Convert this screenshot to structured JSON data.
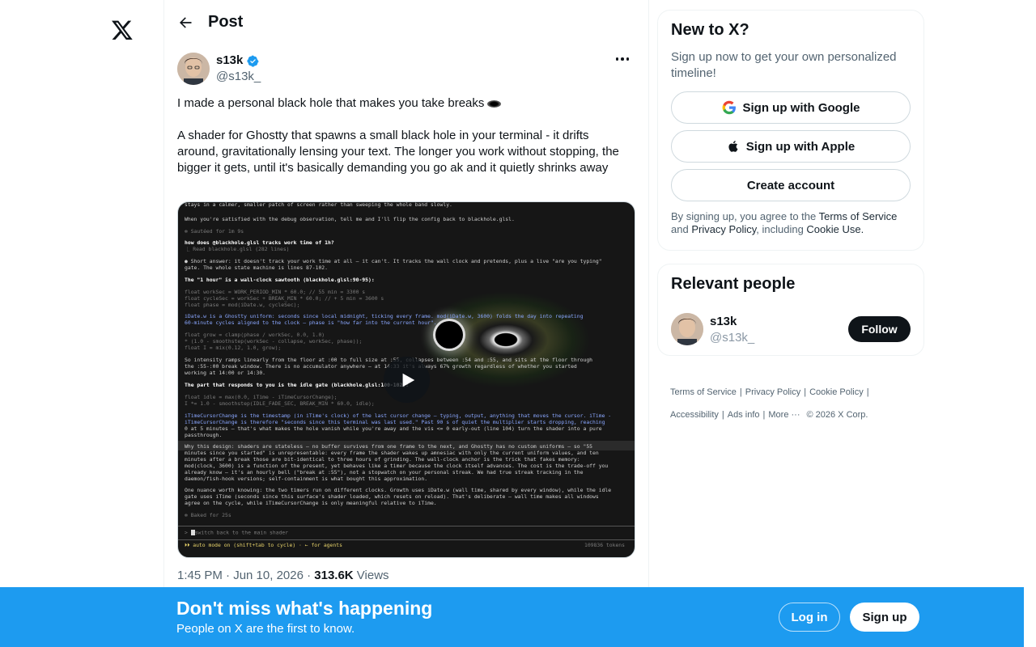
{
  "header": {
    "title": "Post"
  },
  "author": {
    "name": "s13k",
    "handle": "@s13k_"
  },
  "post": {
    "line1": "I made a personal black hole that makes you take breaks",
    "line2": "A shader for Ghostty that spawns a small black hole in your terminal - it drifts around, gravitationally lensing your text. The longer you work without stopping, the bigger it gets, until it's basically demanding you go ak and it quietly shrinks away",
    "time": "1:45 PM · Jun 10, 2026 · ",
    "views": "313.6K",
    "views_label": " Views"
  },
  "terminal": {
    "lines": [
      "stays in a calmer, smaller patch of screen rather than sweeping the whole band slowly.",
      "When you're satisfied with the debug observation, tell me and I'll flip the config back to blackhole.glsl.",
      "✻ Sautéed for 1m 9s",
      "how does @blackhole.glsl tracks work time of 1h?",
      "  ⎿  Read blackhole.glsl (282 lines)",
      "● Short answer: it doesn't track your work time at all — it can't. It tracks the wall clock and pretends, plus a live \"are you typing\"",
      "gate. The whole state machine is lines 87-102.",
      "The \"1 hour\" is a wall-clock sawtooth (blackhole.glsl:90-95):",
      "float workSec  = WORK_PERIOD_MIN * 60.0;          // 55 min = 3300 s",
      "float cycleSec = workSec + BREAK_MIN * 60.0;      // + 5 min = 3600 s",
      "float phase    = mod(iDate.w, cycleSec);",
      "iDate.w is a Ghostty uniform: seconds since local midnight, ticking every frame. mod(iDate.w, 3600) folds the day into repeating",
      "60-minute cycles aligned to the clock — phase is \"how far into the current hour\".",
      "float grow = clamp(phase / workSec, 0.0, 1.0)",
      "           * (1.0 - smoothstep(workSec - collapse, workSec, phase));",
      "float I = mix(0.12, 1.0, grow);",
      "So intensity ramps linearly from the floor at :00 to full size at :55, collapses between :54 and :55, and sits at the floor through",
      "the :55-:00 break window. There is no accumulator anywhere — at 14:33 it's always 67% growth regardless of whether you started",
      "working at 14:00 or 14:30.",
      "The part that responds to you is the idle gate (blackhole.glsl:100-102):",
      "float idle = max(0.0, iTime - iTimeCursorChange);",
      "I *= 1.0 - smoothstep(IDLE_FADE_SEC, BREAK_MIN * 60.0, idle);",
      "iTimeCursorChange is the timestamp (in iTime's clock) of the last cursor change — typing, output, anything that moves the cursor. iTime -",
      "iTimeCursorChange is therefore \"seconds since this terminal was last used.\" Past 90 s of quiet the multiplier starts dropping, reaching",
      "0 at 5 minutes — that's what makes the hole vanish while you're away and the vis <= 0 early-out (line 104) turn the shader into a pure",
      "passthrough.",
      "Why this design: shaders are stateless — no buffer survives from one frame to the next, and Ghostty has no custom uniforms — so \"55",
      "minutes since you started\" is unrepresentable: every frame the shader wakes up amnesiac with only the current uniform values, and ten",
      "minutes after a break those are bit-identical to three hours of grinding. The wall-clock anchor is the trick that fakes memory:",
      "mod(clock, 3600) is a function of the present, yet behaves like a timer because the clock itself advances. The cost is the trade-off you",
      "already know — it's an hourly bell (\"break at :55\"), not a stopwatch on your personal streak. We had true streak tracking in the",
      "daemon/fish-hook versions; self-containment is what bought this approximation.",
      "One nuance worth knowing: the two timers run on different clocks. Growth uses iDate.w (wall time, shared by every window), while the idle",
      "gate uses iTime (seconds since this surface's shader loaded, which resets on reload). That's deliberate — wall time makes all windows",
      "agree on the cycle, while iTimeCursorChange is only meaningful relative to iTime.",
      "✻ Baked for 25s",
      "switch back to the main shader",
      "⏵⏵ auto mode on (shift+tab to cycle) · ← for agents",
      "109836 tokens"
    ]
  },
  "sidebar": {
    "signup_title": "New to X?",
    "signup_sub": "Sign up now to get your own personalized timeline!",
    "google": "Sign up with Google",
    "apple": "Sign up with Apple",
    "create": "Create account",
    "legal_pre": "By signing up, you agree to the ",
    "terms": "Terms of Service",
    "legal_and": " and ",
    "privacy": "Privacy Policy",
    "legal_incl": ", including ",
    "cookie": "Cookie Use.",
    "people_title": "Relevant people",
    "person_name": "s13k",
    "person_handle": "@s13k_",
    "follow": "Follow"
  },
  "footer": {
    "terms": "Terms of Service",
    "privacy": "Privacy Policy",
    "cookie": "Cookie Policy",
    "access": "Accessibility",
    "ads": "Ads info",
    "more": "More ···",
    "copy": "© 2026 X Corp."
  },
  "banner": {
    "title": "Don't miss what's happening",
    "sub": "People on X are the first to know.",
    "login": "Log in",
    "signup": "Sign up"
  },
  "colors": {
    "accent": "#1d9bf0",
    "verified": "#1d9bf0"
  }
}
